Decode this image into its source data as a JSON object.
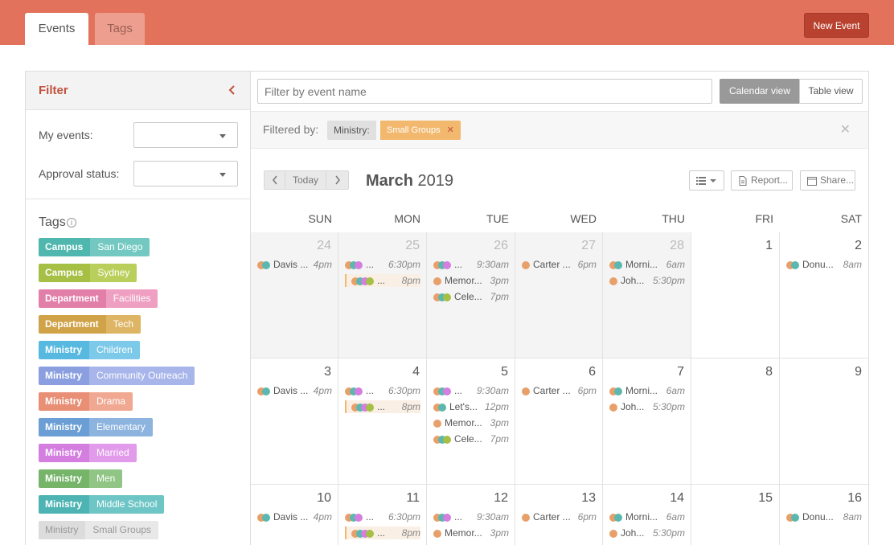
{
  "tabs": [
    {
      "label": "Events"
    },
    {
      "label": "Tags"
    }
  ],
  "actions": {
    "new_event": "New Event"
  },
  "filter": {
    "title": "Filter",
    "my_events_label": "My events:",
    "approval_label": "Approval status:",
    "tags_title": "Tags",
    "tags": [
      {
        "key": "Campus",
        "value": "San Diego",
        "k_color": "#4fb7ae",
        "v_color": "#73c9c2"
      },
      {
        "key": "Campus",
        "value": "Sydney",
        "k_color": "#a6bf45",
        "v_color": "#b9cf5c"
      },
      {
        "key": "Department",
        "value": "Facilities",
        "k_color": "#e27fa9",
        "v_color": "#ee9fc2"
      },
      {
        "key": "Department",
        "value": "Tech",
        "k_color": "#d1a348",
        "v_color": "#ddb564"
      },
      {
        "key": "Ministry",
        "value": "Children",
        "k_color": "#58b9e0",
        "v_color": "#7cc9e9"
      },
      {
        "key": "Ministry",
        "value": "Community Outreach",
        "k_color": "#8b9fe0",
        "v_color": "#a7b5ea"
      },
      {
        "key": "Ministry",
        "value": "Drama",
        "k_color": "#e88f76",
        "v_color": "#f0a892"
      },
      {
        "key": "Ministry",
        "value": "Elementary",
        "k_color": "#6b9ed4",
        "v_color": "#8db3df"
      },
      {
        "key": "Ministry",
        "value": "Married",
        "k_color": "#d47ee0",
        "v_color": "#e19bea"
      },
      {
        "key": "Ministry",
        "value": "Men",
        "k_color": "#76b46a",
        "v_color": "#91c585"
      },
      {
        "key": "Ministry",
        "value": "Middle School",
        "k_color": "#4eb3b3",
        "v_color": "#6ec5c5"
      },
      {
        "key": "Ministry",
        "value": "Small Groups",
        "k_color": "#dcdcdc",
        "v_color": "#e8e8e8"
      }
    ]
  },
  "search": {
    "placeholder": "Filter by event name"
  },
  "views": {
    "calendar": "Calendar view",
    "table": "Table view"
  },
  "filtered_by": {
    "label": "Filtered by:",
    "key": "Ministry:",
    "value": "Small Groups",
    "remove": "✕",
    "clear": "✕"
  },
  "calendar": {
    "today": "Today",
    "month": "March",
    "year": "2019",
    "report": "Report...",
    "share": "Share...",
    "weekdays": [
      "SUN",
      "MON",
      "TUE",
      "WED",
      "THU",
      "FRI",
      "SAT"
    ],
    "weeks": [
      {
        "days": [
          {
            "n": "24",
            "out": true,
            "events": [
              {
                "name": "Davis ...",
                "time": "4pm",
                "dots": [
                  "#e8a06a",
                  "#5bb8b0"
                ]
              }
            ]
          },
          {
            "n": "25",
            "out": true,
            "events": [
              {
                "name": "...",
                "time": "6:30pm",
                "dots": [
                  "#e8a06a",
                  "#5bb8b0",
                  "#d47ee0"
                ]
              },
              {
                "name": "...",
                "time": "8pm",
                "dots": [
                  "#e8a06a",
                  "#5bb8b0",
                  "#d47ee0",
                  "#a6bf45"
                ],
                "bar": true
              }
            ]
          },
          {
            "n": "26",
            "out": true,
            "events": [
              {
                "name": "...",
                "time": "9:30am",
                "dots": [
                  "#e8a06a",
                  "#5bb8b0",
                  "#d47ee0"
                ]
              },
              {
                "name": "Memor...",
                "time": "3pm",
                "dots": [
                  "#e8a06a"
                ]
              },
              {
                "name": "Cele...",
                "time": "7pm",
                "dots": [
                  "#e8a06a",
                  "#5bb8b0",
                  "#a6bf45"
                ]
              }
            ]
          },
          {
            "n": "27",
            "out": true,
            "events": [
              {
                "name": "Carter ...",
                "time": "6pm",
                "dots": [
                  "#e8a06a"
                ]
              }
            ]
          },
          {
            "n": "28",
            "out": true,
            "events": [
              {
                "name": "Morni...",
                "time": "6am",
                "dots": [
                  "#e8a06a",
                  "#5bb8b0"
                ]
              },
              {
                "name": "Joh...",
                "time": "5:30pm",
                "dots": [
                  "#e8a06a"
                ]
              }
            ]
          },
          {
            "n": "1",
            "out": false,
            "events": []
          },
          {
            "n": "2",
            "out": false,
            "events": [
              {
                "name": "Donu...",
                "time": "8am",
                "dots": [
                  "#e8a06a",
                  "#5bb8b0"
                ]
              }
            ]
          }
        ]
      },
      {
        "days": [
          {
            "n": "3",
            "out": false,
            "events": [
              {
                "name": "Davis ...",
                "time": "4pm",
                "dots": [
                  "#e8a06a",
                  "#5bb8b0"
                ]
              }
            ]
          },
          {
            "n": "4",
            "out": false,
            "events": [
              {
                "name": "...",
                "time": "6:30pm",
                "dots": [
                  "#e8a06a",
                  "#5bb8b0",
                  "#d47ee0"
                ]
              },
              {
                "name": "...",
                "time": "8pm",
                "dots": [
                  "#e8a06a",
                  "#5bb8b0",
                  "#d47ee0",
                  "#a6bf45"
                ],
                "bar": true
              }
            ]
          },
          {
            "n": "5",
            "out": false,
            "events": [
              {
                "name": "...",
                "time": "9:30am",
                "dots": [
                  "#e8a06a",
                  "#5bb8b0",
                  "#d47ee0"
                ]
              },
              {
                "name": "Let's...",
                "time": "12pm",
                "dots": [
                  "#e8a06a",
                  "#5bb8b0"
                ]
              },
              {
                "name": "Memor...",
                "time": "3pm",
                "dots": [
                  "#e8a06a"
                ]
              },
              {
                "name": "Cele...",
                "time": "7pm",
                "dots": [
                  "#e8a06a",
                  "#5bb8b0",
                  "#a6bf45"
                ]
              }
            ]
          },
          {
            "n": "6",
            "out": false,
            "events": [
              {
                "name": "Carter ...",
                "time": "6pm",
                "dots": [
                  "#e8a06a"
                ]
              }
            ]
          },
          {
            "n": "7",
            "out": false,
            "events": [
              {
                "name": "Morni...",
                "time": "6am",
                "dots": [
                  "#e8a06a",
                  "#5bb8b0"
                ]
              },
              {
                "name": "Joh...",
                "time": "5:30pm",
                "dots": [
                  "#e8a06a"
                ]
              }
            ]
          },
          {
            "n": "8",
            "out": false,
            "events": []
          },
          {
            "n": "9",
            "out": false,
            "events": []
          }
        ]
      },
      {
        "days": [
          {
            "n": "10",
            "out": false,
            "events": [
              {
                "name": "Davis ...",
                "time": "4pm",
                "dots": [
                  "#e8a06a",
                  "#5bb8b0"
                ]
              }
            ]
          },
          {
            "n": "11",
            "out": false,
            "events": [
              {
                "name": "...",
                "time": "6:30pm",
                "dots": [
                  "#e8a06a",
                  "#5bb8b0",
                  "#d47ee0"
                ]
              },
              {
                "name": "...",
                "time": "8pm",
                "dots": [
                  "#e8a06a",
                  "#5bb8b0",
                  "#d47ee0",
                  "#a6bf45"
                ],
                "bar": true
              }
            ]
          },
          {
            "n": "12",
            "out": false,
            "events": [
              {
                "name": "...",
                "time": "9:30am",
                "dots": [
                  "#e8a06a",
                  "#5bb8b0",
                  "#d47ee0"
                ]
              },
              {
                "name": "Memor...",
                "time": "3pm",
                "dots": [
                  "#e8a06a"
                ]
              }
            ]
          },
          {
            "n": "13",
            "out": false,
            "events": [
              {
                "name": "Carter ...",
                "time": "6pm",
                "dots": [
                  "#e8a06a"
                ]
              }
            ]
          },
          {
            "n": "14",
            "out": false,
            "events": [
              {
                "name": "Morni...",
                "time": "6am",
                "dots": [
                  "#e8a06a",
                  "#5bb8b0"
                ]
              },
              {
                "name": "Joh...",
                "time": "5:30pm",
                "dots": [
                  "#e8a06a"
                ]
              }
            ]
          },
          {
            "n": "15",
            "out": false,
            "events": []
          },
          {
            "n": "16",
            "out": false,
            "events": [
              {
                "name": "Donu...",
                "time": "8am",
                "dots": [
                  "#e8a06a",
                  "#5bb8b0"
                ]
              }
            ]
          }
        ]
      }
    ]
  }
}
